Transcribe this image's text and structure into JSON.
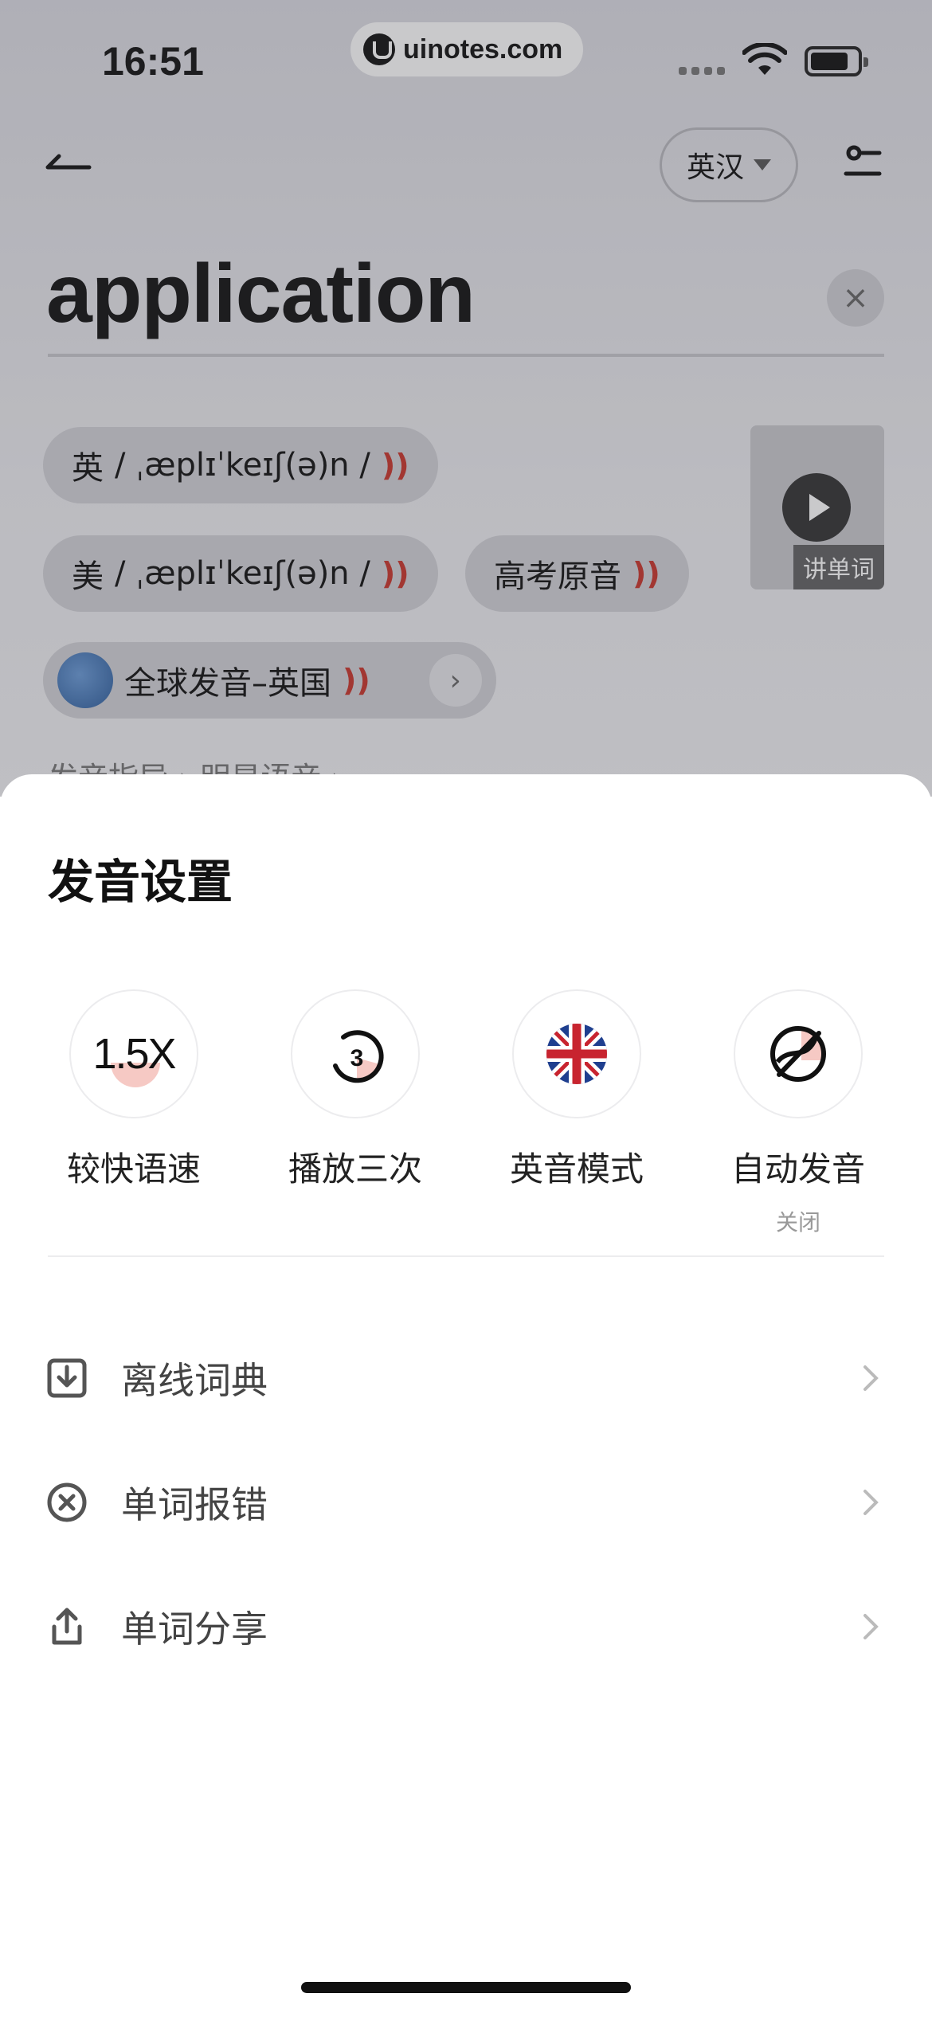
{
  "status_bar": {
    "time": "16:51",
    "url": "uinotes.com"
  },
  "header": {
    "lang_selector": "英汉"
  },
  "search": {
    "word": "application",
    "clear": "×"
  },
  "pronunciations": [
    {
      "prefix": "英",
      "ipa": "/ ˌæplɪˈkeɪʃ(ə)n /"
    },
    {
      "prefix": "美",
      "ipa": "/ ˌæplɪˈkeɪʃ(ə)n /"
    }
  ],
  "gaokao_chip": "高考原音",
  "global_chip": "全球发音–英国",
  "video": {
    "label": "讲单词"
  },
  "peek_links": "发音指导 ›   明星语音 ›",
  "sheet": {
    "title": "发音设置",
    "options": [
      {
        "icon": "speed-icon",
        "icon_text": "1.5X",
        "label": "较快语速",
        "sub": ""
      },
      {
        "icon": "replay-three-icon",
        "icon_text": "3",
        "label": "播放三次",
        "sub": ""
      },
      {
        "icon": "uk-flag-icon",
        "label": "英音模式",
        "sub": ""
      },
      {
        "icon": "auto-play-off-icon",
        "label": "自动发音",
        "sub": "关闭"
      }
    ],
    "menu": [
      {
        "icon": "download-icon",
        "label": "离线词典"
      },
      {
        "icon": "error-report-icon",
        "label": "单词报错"
      },
      {
        "icon": "share-icon",
        "label": "单词分享"
      }
    ]
  },
  "colors": {
    "accent_red": "#c9352b",
    "pink_fill": "#f6c9c4"
  }
}
